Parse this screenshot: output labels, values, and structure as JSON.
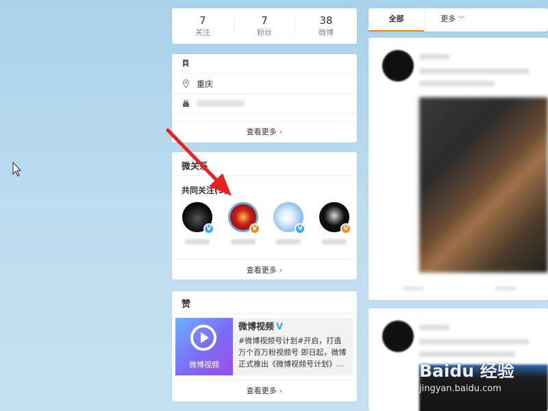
{
  "stats": [
    {
      "num": "7",
      "label": "关注"
    },
    {
      "num": "7",
      "label": "粉丝"
    },
    {
      "num": "38",
      "label": "微博"
    }
  ],
  "info": {
    "location": "重庆",
    "more_label": "查看更多"
  },
  "relations": {
    "title": "微关系",
    "subtitle": "共同关注(5)",
    "more_label": "查看更多",
    "avatars": [
      {
        "badge": "V",
        "badge_color": "#3ba8ee"
      },
      {
        "badge": "V",
        "badge_color": "#f08b1f"
      },
      {
        "badge": "V",
        "badge_color": "#3ba8ee"
      },
      {
        "badge": "V",
        "badge_color": "#f08b1f"
      }
    ]
  },
  "like": {
    "title": "赞",
    "promo_title": "微博视频",
    "promo_img_label": "微博视频",
    "promo_desc": "#微博视频号计划#开启，打造万个百万粉视频号 即日起，微博正式推出《微博视频号计划》...",
    "more_label": "查看更多"
  },
  "feed": {
    "tabs": [
      {
        "label": "全部"
      },
      {
        "label": "更多"
      }
    ]
  },
  "watermark": {
    "logo": "Baidu 经验",
    "url": "jingyan.baidu.com"
  },
  "colors": {
    "accent": "#ff8200",
    "verified_blue": "#3ba8ee",
    "verified_orange": "#f08b1f",
    "arrow": "#e8231f"
  }
}
